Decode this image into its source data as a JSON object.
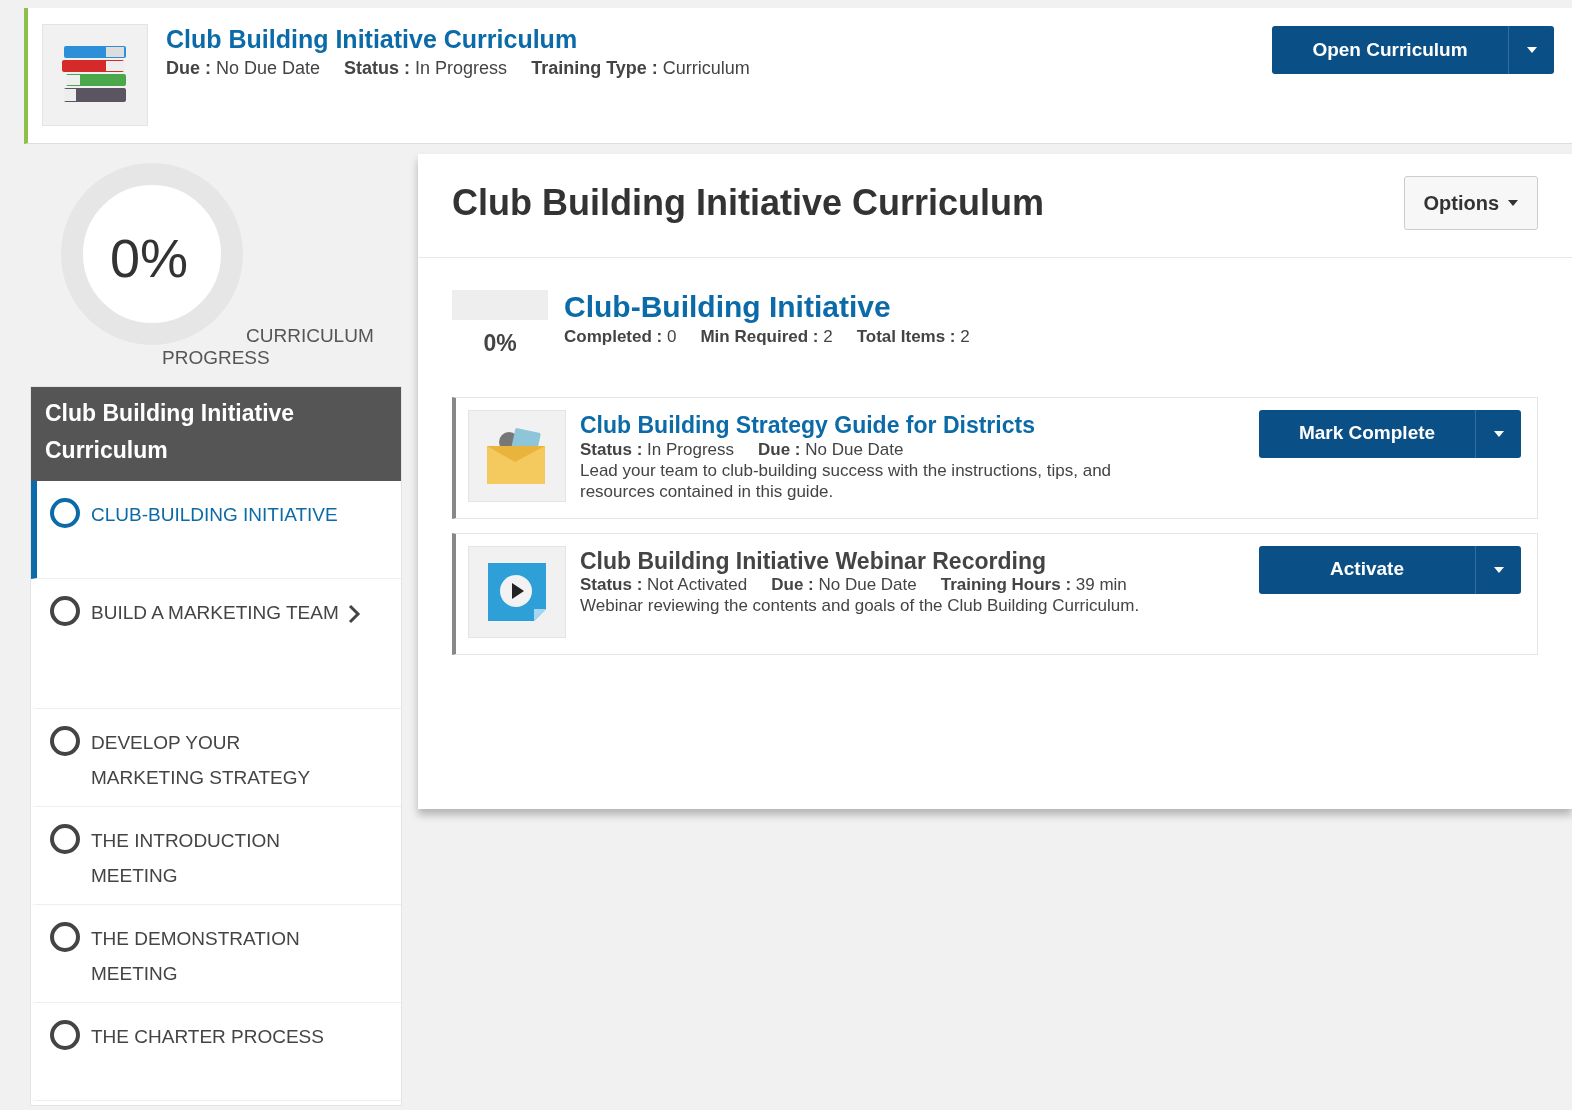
{
  "header": {
    "title": "Club Building Initiative Curriculum",
    "meta": [
      "**Due :** No Due Date",
      "**Status :** In Progress",
      "**Training Type :** Curriculum"
    ],
    "button": "Open Curriculum"
  },
  "progress": {
    "reading": "0%",
    "caption_1": "CURRICULUM",
    "caption_2": "PROGRESS"
  },
  "sidebar": {
    "title": "Club Building Initiative Curriculum",
    "items": [
      {
        "label": "CLUB-BUILDING INITIATIVE",
        "selected": true,
        "expandable": false
      },
      {
        "label": "BUILD A MARKETING TEAM",
        "selected": false,
        "expandable": true
      },
      {
        "label": "DEVELOP YOUR MARKETING STRATEGY",
        "selected": false,
        "expandable": false
      },
      {
        "label": "THE INTRODUCTION MEETING",
        "selected": false,
        "expandable": false
      },
      {
        "label": "THE DEMONSTRATION MEETING",
        "selected": false,
        "expandable": false
      },
      {
        "label": "THE CHARTER PROCESS",
        "selected": false,
        "expandable": false
      }
    ]
  },
  "main": {
    "title": "Club Building Initiative Curriculum",
    "options_button": "Options",
    "section": {
      "title": "Club-Building Initiative",
      "level": 0,
      "reading": "0%",
      "meta": [
        "**Completed :** 0",
        "**Min Required :** 2",
        "**Total Items :** 2"
      ]
    },
    "items": [
      {
        "kind": "document",
        "title": "Club Building Strategy Guide for Districts",
        "link": true,
        "meta": [
          "**Status :** In Progress",
          "**Due :** No Due Date"
        ],
        "description": "Lead your team to club-building success with the instructions, tips, and resources contained in this guide.",
        "button": "Mark Complete"
      },
      {
        "kind": "video",
        "title": "Club Building Initiative Webinar Recording",
        "link": false,
        "meta": [
          "**Status :** Not Activated",
          "**Due :** No Due Date",
          "**Training Hours :** 39 min"
        ],
        "description": "Webinar reviewing the contents and goals of the Club Building Curriculum.",
        "button": "Activate"
      }
    ]
  }
}
